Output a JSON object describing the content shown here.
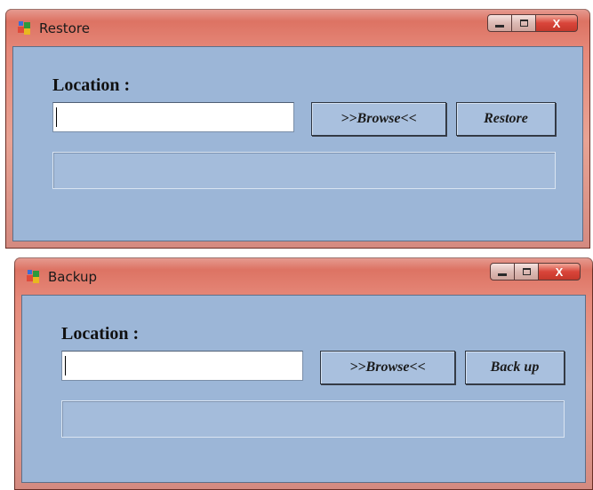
{
  "restore_window": {
    "title": "Restore",
    "location_label": "Location :",
    "path_value": "",
    "browse_label": ">>Browse<<",
    "action_label": "Restore",
    "progress": 0
  },
  "backup_window": {
    "title": "Backup",
    "location_label": "Location :",
    "path_value": "",
    "browse_label": ">>Browse<<",
    "action_label": "Back up",
    "progress": 0
  },
  "caption": {
    "close_glyph": "X"
  },
  "icons": [
    "app-icon",
    "minimize-icon",
    "maximize-icon",
    "close-icon"
  ],
  "colors": {
    "client_bg": "#9cb6d7",
    "titlebar": "#e08a7a",
    "close_button": "#d9453a"
  }
}
